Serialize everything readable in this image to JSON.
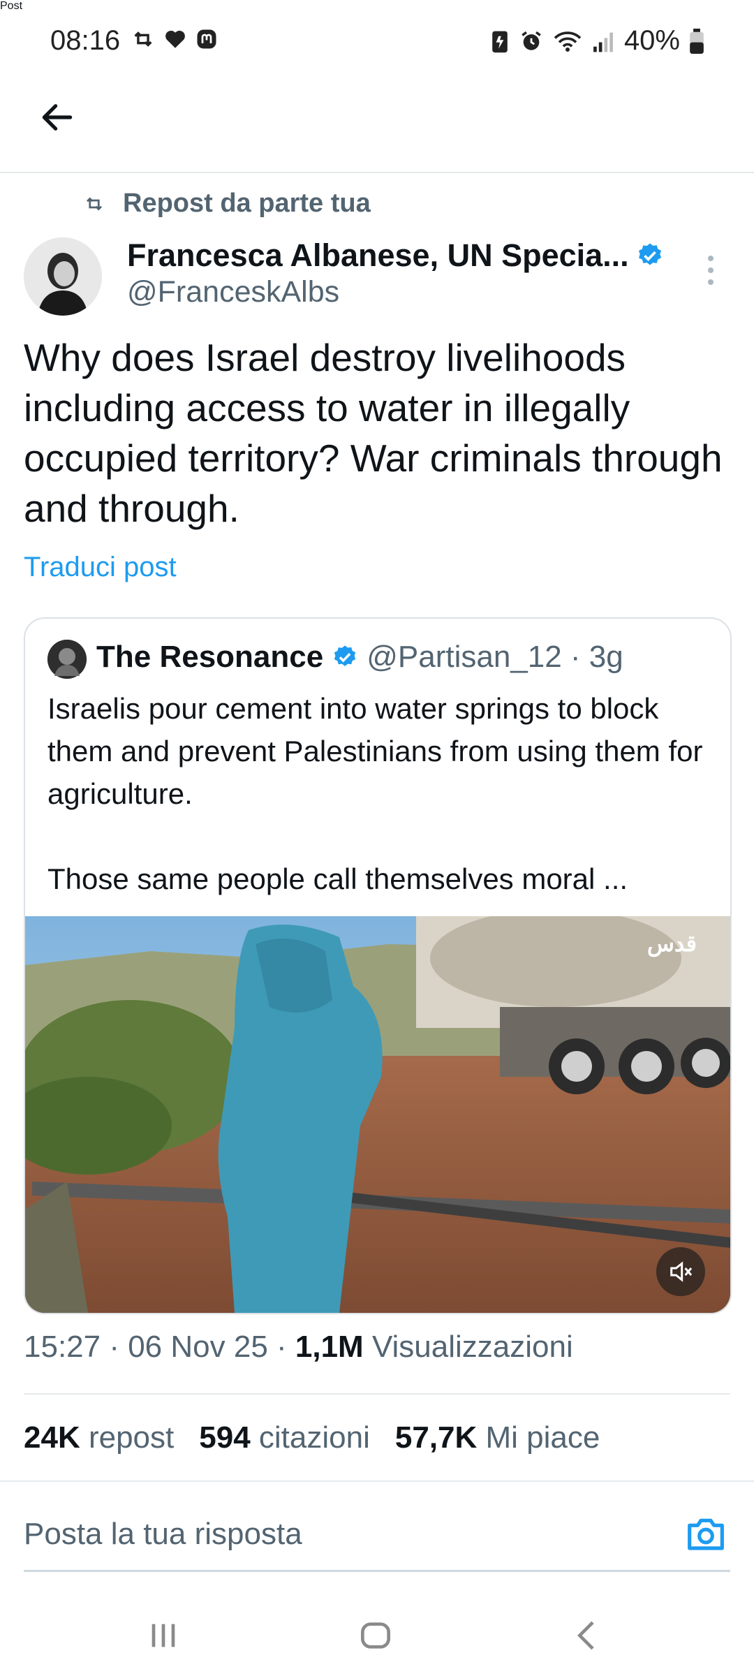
{
  "status_bar": {
    "time": "08:16",
    "battery": "40%"
  },
  "header": {
    "title": "Post"
  },
  "repost_label": "Repost da parte tua",
  "author": {
    "name": "Francesca Albanese, UN Specia...",
    "handle": "@FranceskAlbs"
  },
  "post": {
    "text": "Why does Israel destroy livelihoods including access to water in illegally occupied territory? War criminals through and through.",
    "translate_label": "Traduci post"
  },
  "quote": {
    "name": "The Resonance",
    "meta": "@Partisan_12 · 3g",
    "text": "Israelis pour cement into water springs to block them and prevent Palestinians from using them for agriculture.\n\nThose same people call themselves moral ...",
    "video_watermark": "قدس"
  },
  "meta": {
    "datetime": "15:27 · 06 Nov 25 · ",
    "views_value": "1,1M",
    "views_label": " Visualizzazioni"
  },
  "stats": {
    "reposts_value": "24K",
    "reposts_label": "repost",
    "quotes_value": "594",
    "quotes_label": "citazioni",
    "likes_value": "57,7K",
    "likes_label": "Mi piace"
  },
  "reply": {
    "placeholder": "Posta la tua risposta"
  },
  "colors": {
    "accent": "#1d9bf0",
    "secondary_text": "#536471",
    "primary_text": "#0f1419"
  }
}
